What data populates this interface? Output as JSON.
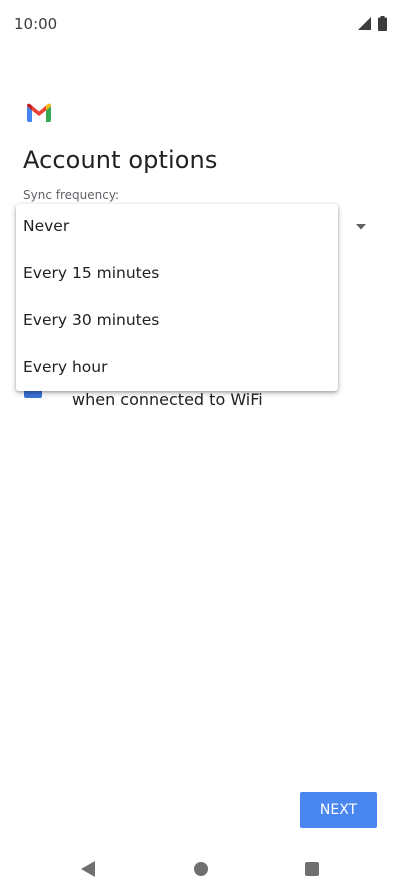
{
  "status_bar": {
    "time": "10:00",
    "signal_icon": "cellular-signal-icon",
    "battery_icon": "battery-icon"
  },
  "header": {
    "logo_icon": "gmail-icon",
    "title": "Account options"
  },
  "sync": {
    "label": "Sync frequency:",
    "dropdown_icon": "dropdown-arrow-icon",
    "options": [
      {
        "label": "Never"
      },
      {
        "label": "Every 15 minutes"
      },
      {
        "label": "Every 30 minutes"
      },
      {
        "label": "Every hour"
      }
    ]
  },
  "wifi_option": {
    "label": "when connected to WiFi",
    "checked": true
  },
  "footer": {
    "next_label": "NEXT"
  },
  "nav_bar": {
    "back_icon": "back-triangle-icon",
    "home_icon": "home-circle-icon",
    "recents_icon": "recents-square-icon"
  },
  "colors": {
    "accent": "#4a86f0",
    "text": "#202124",
    "secondary_text": "#5f6368"
  }
}
